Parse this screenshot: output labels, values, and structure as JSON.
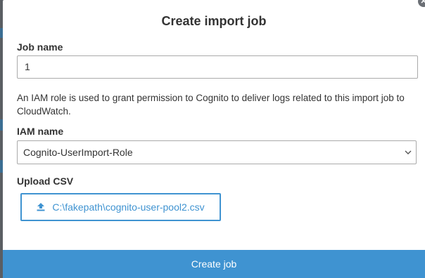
{
  "modal": {
    "title": "Create import job",
    "close_icon": "close-icon"
  },
  "job_name": {
    "label": "Job name",
    "value": "1"
  },
  "description": "An IAM role is used to grant permission to Cognito to deliver logs related to this import job to CloudWatch.",
  "iam_name": {
    "label": "IAM name",
    "selected": "Cognito-UserImport-Role",
    "icon": "chevron-down-icon"
  },
  "upload_csv": {
    "label": "Upload CSV",
    "file": "C:\\fakepath\\cognito-user-pool2.csv",
    "icon": "upload-icon"
  },
  "footer": {
    "create_label": "Create job"
  },
  "colors": {
    "accent": "#3f93d1",
    "text": "#333333",
    "border": "#aaaaaa"
  }
}
